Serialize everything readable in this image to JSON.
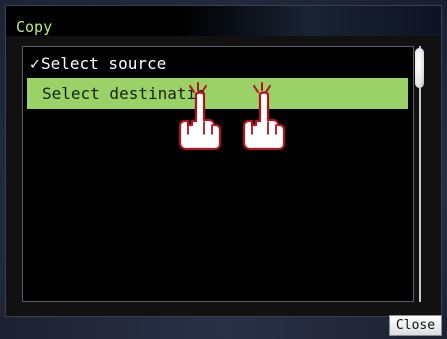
{
  "window": {
    "title": "Copy"
  },
  "list": {
    "items": [
      {
        "check": "✓",
        "label": "Select source",
        "selected": false
      },
      {
        "label": "Select destinatio",
        "selected": true
      }
    ]
  },
  "footer": {
    "close_label": "Close"
  },
  "icons": {
    "checkmark": "check-icon",
    "tap_gesture": "double-tap-hand-icon",
    "scroll": "scrollbar-thumb"
  },
  "colors": {
    "title_text": "#b9ec7a",
    "highlight": "#9bd267",
    "background": "#000000",
    "hand_outline": "#b0141c"
  }
}
